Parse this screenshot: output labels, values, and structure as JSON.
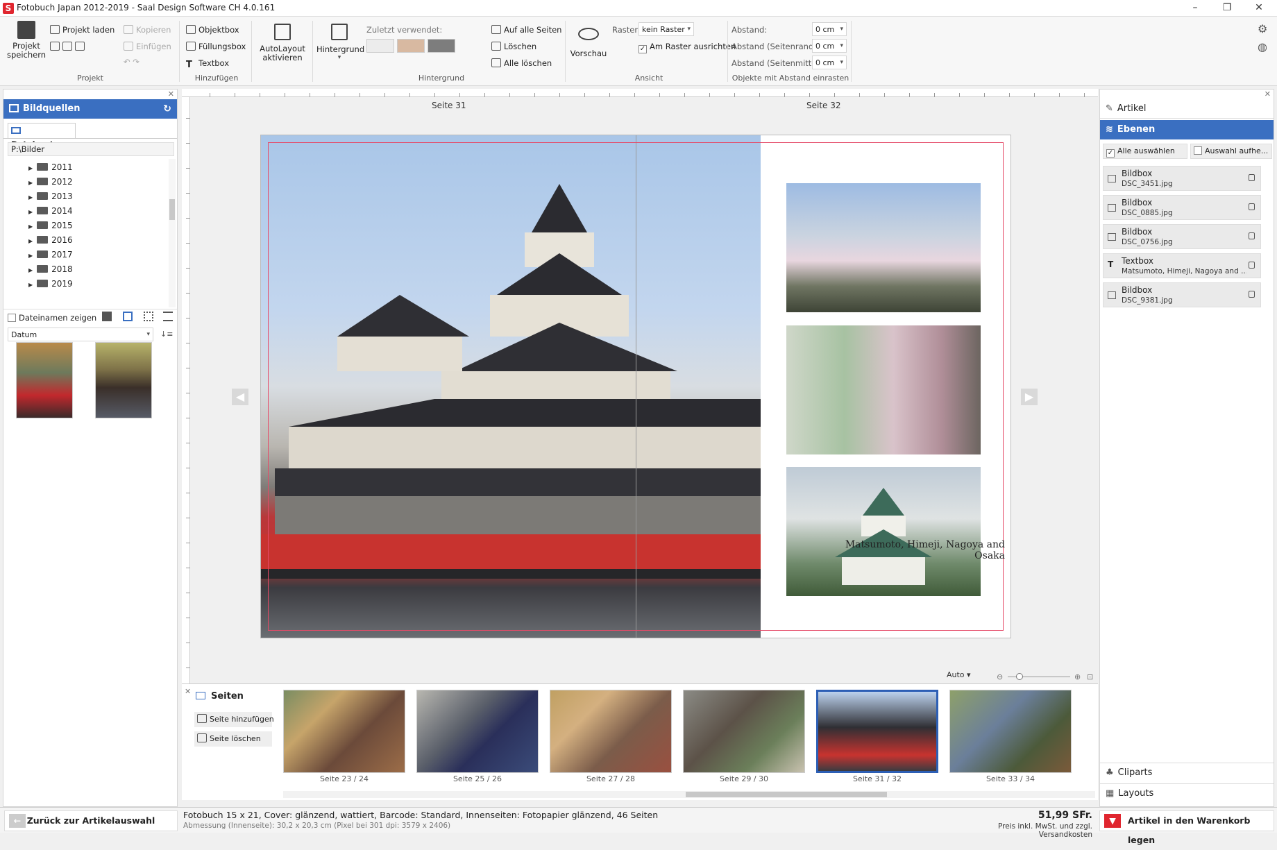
{
  "window": {
    "title": "Fotobuch Japan 2012-2019 - Saal Design Software CH 4.0.161",
    "logo": "S"
  },
  "ribbon": {
    "projekt": {
      "save": "Projekt speichern",
      "load": "Projekt laden",
      "copy": "Kopieren",
      "paste": "Einfügen",
      "group": "Projekt"
    },
    "hinzufuegen": {
      "objektbox": "Objektbox",
      "fuellungsbox": "Füllungsbox",
      "textbox": "Textbox",
      "group": "Hinzufügen"
    },
    "autolayout": "AutoLayout aktivieren",
    "hintergrund": {
      "label": "Hintergrund",
      "recent": "Zuletzt verwendet:",
      "all_pages": "Auf alle Seiten",
      "delete": "Löschen",
      "delete_all": "Alle löschen",
      "group": "Hintergrund",
      "swatches": [
        "#ececec",
        "#d8b9a1",
        "#7d7d7d"
      ]
    },
    "ansicht": {
      "preview": "Vorschau",
      "raster_label": "Raster:",
      "raster_value": "kein Raster",
      "snap": "Am Raster ausrichten",
      "group": "Ansicht"
    },
    "abstand": {
      "abstand": "Abstand:",
      "seitenrand": "Abstand (Seitenrand):",
      "seitenmitte": "Abstand (Seitenmitte):",
      "value": "0 cm",
      "group": "Objekte mit Abstand einrasten"
    }
  },
  "left": {
    "title": "Bildquellen",
    "tab": "Dateisystem",
    "path": "P:\\Bilder",
    "folders": [
      "2011",
      "2012",
      "2013",
      "2014",
      "2015",
      "2016",
      "2017",
      "2018",
      "2019"
    ],
    "show_names": "Dateinamen zeigen",
    "sort": "Datum"
  },
  "canvas": {
    "page_left": "Seite 31",
    "page_right": "Seite 32",
    "caption": "Matsumoto, Himeji, Nagoya and Osaka",
    "zoom": "Auto"
  },
  "right": {
    "artikel": "Artikel",
    "ebenen": "Ebenen",
    "select_all": "Alle auswählen",
    "deselect": "Auswahl aufhe...",
    "layers": [
      {
        "type": "Bildbox",
        "name": "DSC_3451.jpg"
      },
      {
        "type": "Bildbox",
        "name": "DSC_0885.jpg"
      },
      {
        "type": "Bildbox",
        "name": "DSC_0756.jpg"
      },
      {
        "type": "Textbox",
        "name": "Matsumoto, Himeji, Nagoya and ..."
      },
      {
        "type": "Bildbox",
        "name": "DSC_9381.jpg"
      }
    ],
    "cliparts": "Cliparts",
    "layouts": "Layouts"
  },
  "pages": {
    "title": "Seiten",
    "add": "Seite hinzufügen",
    "delete": "Seite löschen",
    "thumbs": [
      "Seite 23 / 24",
      "Seite 25 / 26",
      "Seite 27 / 28",
      "Seite 29 / 30",
      "Seite 31 / 32",
      "Seite 33 / 34"
    ]
  },
  "status": {
    "back": "Zurück zur Artikelauswahl",
    "info": "Fotobuch 15 x 21, Cover: glänzend, wattiert, Barcode: Standard, Innenseiten: Fotopapier glänzend, 46 Seiten",
    "dim": "Abmessung (Innenseite): 30,2 x 20,3 cm (Pixel bei 301 dpi: 3579 x 2406)",
    "price": "51,99 SFr.",
    "price_note": "Preis inkl. MwSt. und zzgl. Versandkosten",
    "cart": "Artikel in den Warenkorb legen"
  }
}
